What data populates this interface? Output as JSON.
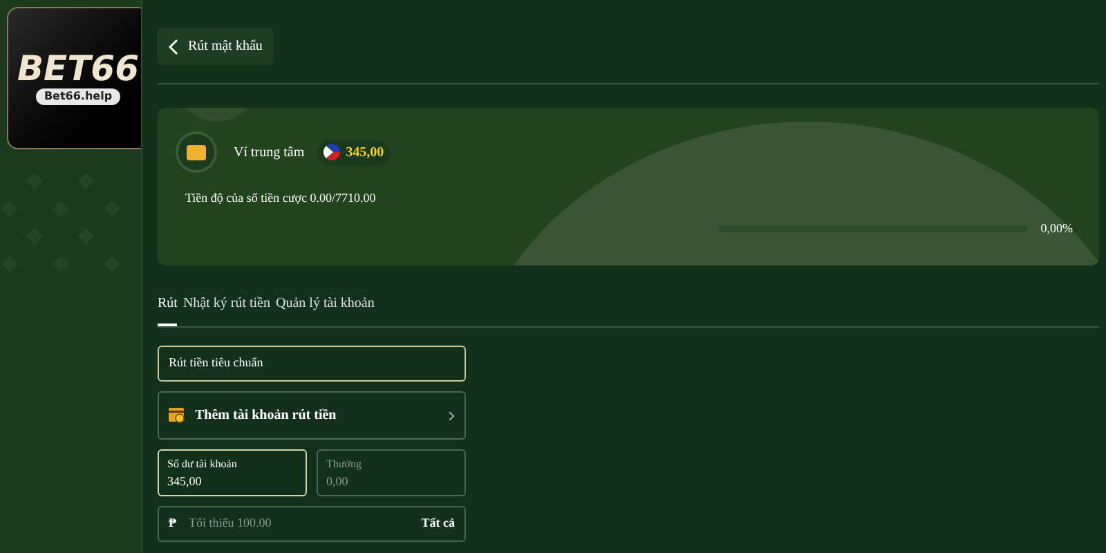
{
  "logo": {
    "brand": "BET66",
    "domain": "Bet66.help"
  },
  "header": {
    "back_label": "Rút mật khẩu"
  },
  "wallet": {
    "name": "Ví trung tâm",
    "amount": "345,00",
    "progress_label": "Tiền độ của số tiền cược 0.00/7710.00",
    "progress": {
      "level": 0,
      "reading": "0,00%"
    }
  },
  "tabs": [
    {
      "label": "Rút",
      "selected": true
    },
    {
      "label": "Nhật ký rút tiền",
      "selected": false
    },
    {
      "label": "Quản lý tài khoản",
      "selected": false
    }
  ],
  "method": "Rút tiền tiêu chuẩn",
  "add_account": "Thêm tài khoản rút tiền",
  "balances": [
    {
      "label": "Số dư tài khoản",
      "value": "345,00",
      "selected": true
    },
    {
      "label": "Thưởng",
      "value": "0,00",
      "selected": false
    }
  ],
  "amount_field": {
    "currency": "₱",
    "placeholder": "Tối thiểu 100.00",
    "all_label": "Tất cả"
  }
}
